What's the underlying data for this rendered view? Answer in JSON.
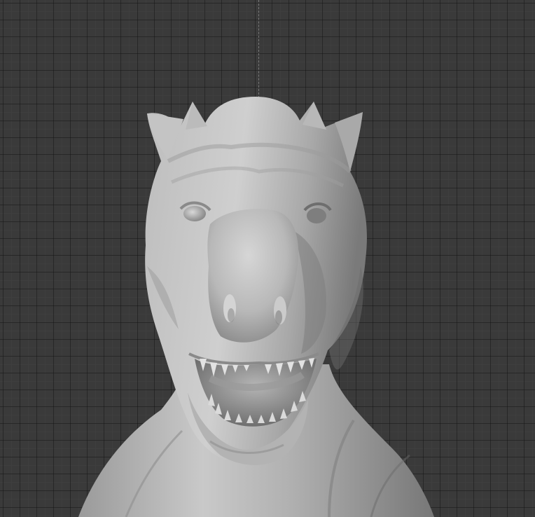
{
  "viewport": {
    "object": "dinosaur-head-sculpt",
    "shading": "solid-gray",
    "colors": {
      "background": "#3a3a3a",
      "grid_major": "#1e1e1e",
      "grid_minor": "#464646",
      "mesh_light": "#c8c8c8",
      "mesh_mid": "#a6a6a6",
      "mesh_dark": "#6e6e6e",
      "mouth_interior": "#8f8f8f"
    }
  }
}
